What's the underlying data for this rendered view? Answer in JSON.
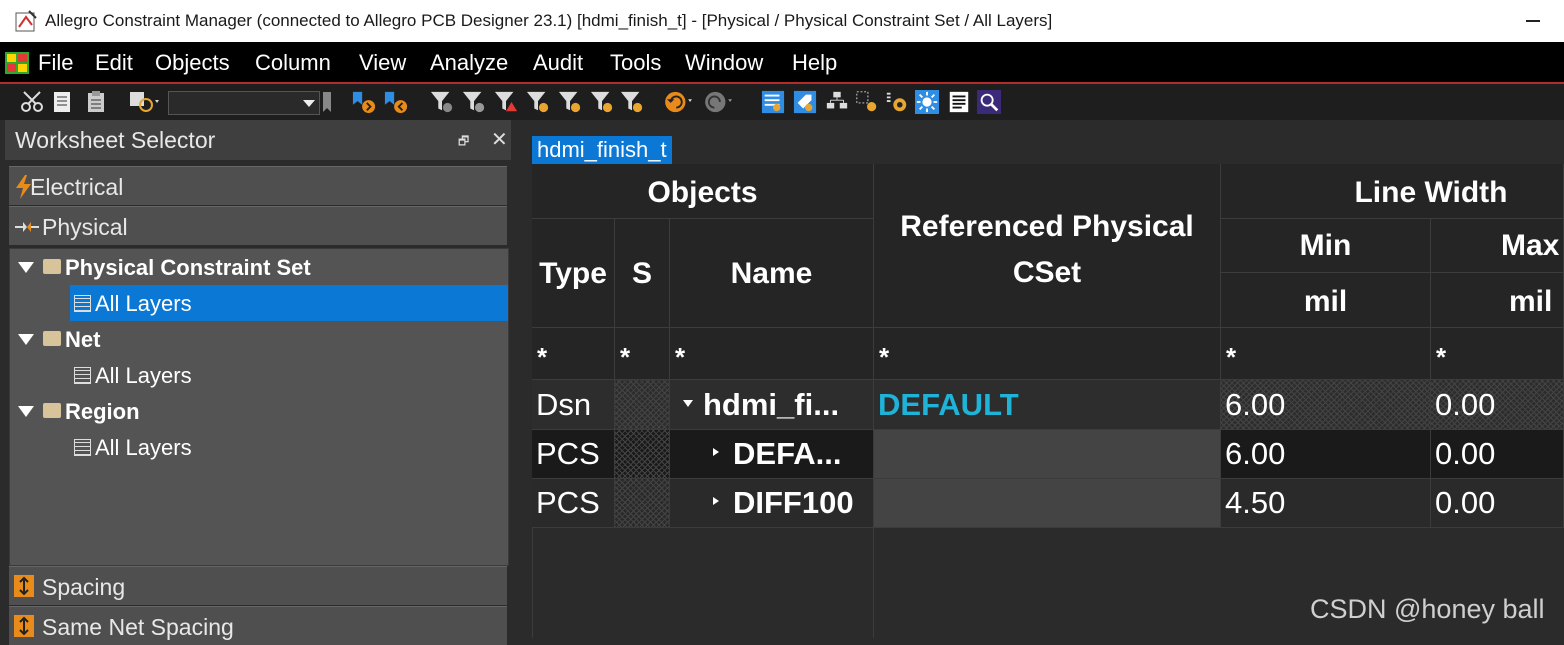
{
  "window": {
    "title": "Allegro Constraint Manager (connected to Allegro PCB Designer 23.1) [hdmi_finish_t] - [Physical / Physical Constraint Set / All Layers]"
  },
  "menu": [
    "File",
    "Edit",
    "Objects",
    "Column",
    "View",
    "Analyze",
    "Audit",
    "Tools",
    "Window",
    "Help"
  ],
  "toolbar": {
    "combo_value": ""
  },
  "worksheet_selector": {
    "title": "Worksheet Selector",
    "sections": {
      "electrical": "Electrical",
      "physical": "Physical",
      "spacing": "Spacing",
      "same_net_spacing": "Same Net Spacing"
    },
    "tree": [
      {
        "label": "Physical Constraint Set",
        "child": "All Layers",
        "selected": true
      },
      {
        "label": "Net",
        "child": "All Layers"
      },
      {
        "label": "Region",
        "child": "All Layers"
      }
    ]
  },
  "worksheet": {
    "tab": "hdmi_finish_t",
    "headers": {
      "objects": "Objects",
      "type": "Type",
      "s": "S",
      "name": "Name",
      "ref_cset": "Referenced Physical CSet",
      "line_width": "Line Width",
      "min": "Min",
      "max": "Max",
      "min_unit": "mil",
      "max_unit": "mil"
    },
    "filter": "*",
    "rows": [
      {
        "type": "Dsn",
        "name": "hdmi_fi...",
        "ref": "DEFAULT",
        "min": "6.00",
        "max": "0.00"
      },
      {
        "type": "PCS",
        "name": "DEFA...",
        "ref": "",
        "min": "6.00",
        "max": "0.00"
      },
      {
        "type": "PCS",
        "name": "DIFF100",
        "ref": "",
        "min": "4.50",
        "max": "0.00"
      }
    ]
  },
  "watermark": "CSDN @honey ball"
}
